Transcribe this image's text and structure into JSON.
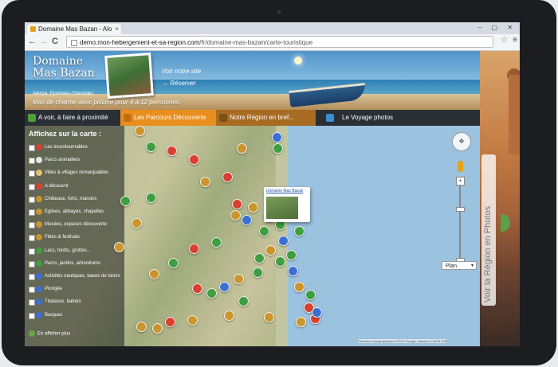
{
  "browser": {
    "tab_title": "Domaine Mas Bazan - Alo",
    "url_host": "demo.mon-hebergement-et-sa-region.com",
    "url_path": "/fr/domaine-mas-bazan/carte-touristique",
    "win_controls": "– ▢ ✕",
    "back": "←",
    "forward": "→",
    "reload": "C",
    "star": "☆",
    "menu": "≡"
  },
  "header": {
    "logo_line1": "Domaine",
    "logo_line2": "Mas Bazan",
    "location": "Alenya, Pyrénées-Orientales",
    "tagline": "Mas de charme avec piscine pour 4 à 12 personnes.",
    "link_voir": "Voir notre site",
    "link_reserver": "→ Réserver"
  },
  "nav": [
    {
      "label": "A voir, à faire à proximité",
      "color": "#4e9e3c"
    },
    {
      "label": "Les Parcours Découverte",
      "color": "#e88f1f"
    },
    {
      "label": "Notre Région en bref...",
      "color": "#b77b25"
    },
    {
      "label": "Le Voyage photos",
      "color": "#3b8fd1"
    }
  ],
  "legend": {
    "title": "Affichez sur la carte :",
    "items": [
      {
        "label": "Les incontournables",
        "color": "#d8402f"
      },
      {
        "label": "Parcs animaliers",
        "color": "#e7e7e7"
      },
      {
        "label": "Villes & villages remarquables",
        "color": "#e0c46b"
      },
      {
        "label": "A découvrir",
        "color": "#d8402f"
      },
      {
        "label": "Châteaux, forts, manoirs",
        "color": "#c9952c"
      },
      {
        "label": "Eglises, abbayes, chapelles",
        "color": "#c9952c"
      },
      {
        "label": "Musées, espaces découverte",
        "color": "#c9952c"
      },
      {
        "label": "Fêtes & festivals",
        "color": "#c9952c"
      },
      {
        "label": "Lacs, forêts, grottes...",
        "color": "#3f9e3f"
      },
      {
        "label": "Parcs, jardins, arboretums",
        "color": "#3f9e3f"
      },
      {
        "label": "Activités nautiques, bases de loisirs",
        "color": "#3b6fd1"
      },
      {
        "label": "Plongée",
        "color": "#3b6fd1"
      },
      {
        "label": "Thalasso, balnéo",
        "color": "#3b6fd1"
      },
      {
        "label": "Barques",
        "color": "#3b6fd1"
      }
    ],
    "more": "En afficher plus"
  },
  "map": {
    "popup_title": "Domaine Mas Bazan",
    "map_type": "Plan",
    "attribution": "Données cartographiques ©2013 Google, basado en BCN IGN",
    "side_panel": "Voir la Région en Photos",
    "zoom_plus": "+",
    "zoom_minus": "−",
    "pan_icon": "✥",
    "plan_caret": "▾"
  }
}
